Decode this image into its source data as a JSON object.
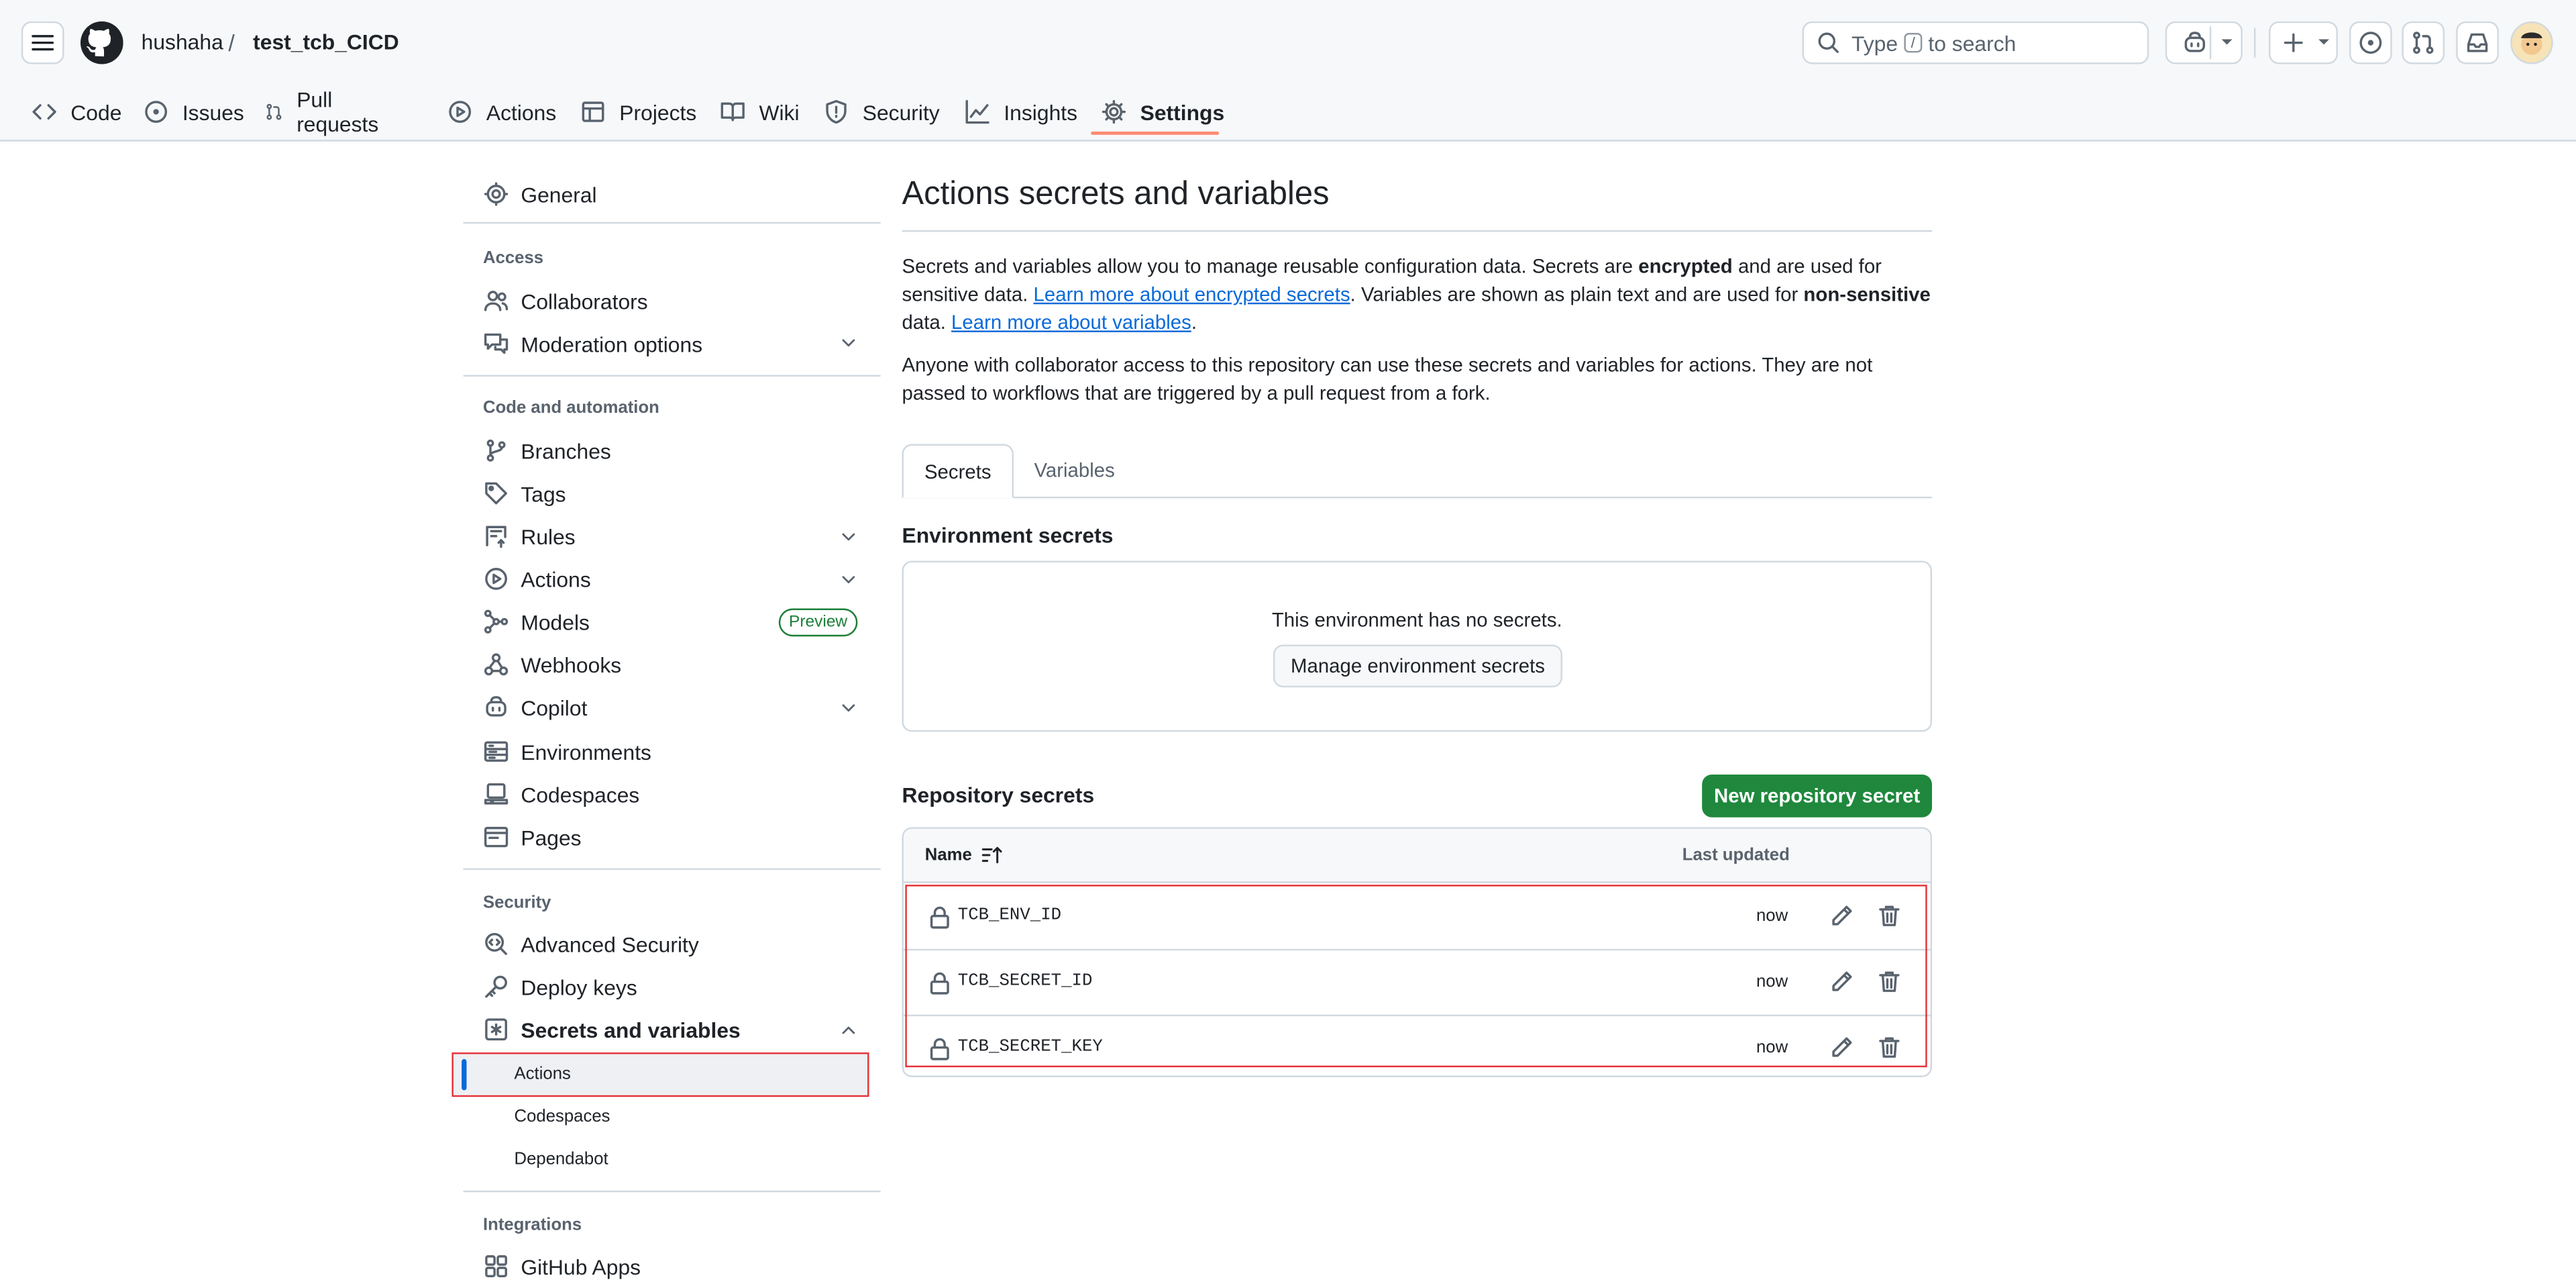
{
  "header": {
    "owner": "hushaha",
    "separator": "/",
    "repo": "test_tcb_CICD",
    "search_text_before": "Type",
    "search_key": "/",
    "search_text_after": "to search"
  },
  "repo_tabs": [
    {
      "label": "Code",
      "icon": "code-icon"
    },
    {
      "label": "Issues",
      "icon": "issue-icon"
    },
    {
      "label": "Pull requests",
      "icon": "pull-request-icon"
    },
    {
      "label": "Actions",
      "icon": "play-icon"
    },
    {
      "label": "Projects",
      "icon": "table-icon"
    },
    {
      "label": "Wiki",
      "icon": "book-icon"
    },
    {
      "label": "Security",
      "icon": "shield-icon"
    },
    {
      "label": "Insights",
      "icon": "graph-icon"
    },
    {
      "label": "Settings",
      "icon": "gear-icon",
      "active": true
    }
  ],
  "sidebar": {
    "general": "General",
    "access_heading": "Access",
    "collaborators": "Collaborators",
    "moderation": "Moderation options",
    "code_heading": "Code and automation",
    "branches": "Branches",
    "tags": "Tags",
    "rules": "Rules",
    "actions": "Actions",
    "models": "Models",
    "preview_badge": "Preview",
    "webhooks": "Webhooks",
    "copilot": "Copilot",
    "environments": "Environments",
    "codespaces": "Codespaces",
    "pages": "Pages",
    "security_heading": "Security",
    "advanced_security": "Advanced Security",
    "deploy_keys": "Deploy keys",
    "secrets_variables": "Secrets and variables",
    "sub_actions": "Actions",
    "sub_codespaces": "Codespaces",
    "sub_dependabot": "Dependabot",
    "integrations_heading": "Integrations",
    "github_apps": "GitHub Apps"
  },
  "main": {
    "title": "Actions secrets and variables",
    "intro_1": "Secrets and variables allow you to manage reusable configuration data. Secrets are ",
    "intro_bold_1": "encrypted",
    "intro_2": " and are used for sensitive data. ",
    "intro_link_1": "Learn more about encrypted secrets",
    "intro_3": ". Variables are shown as plain text and are used for ",
    "intro_bold_2": "non-sensitive",
    "intro_4": " data. ",
    "intro_link_2": "Learn more about variables",
    "intro_5": ".",
    "access_note": "Anyone with collaborator access to this repository can use these secrets and variables for actions. They are not passed to workflows that are triggered by a pull request from a fork.",
    "tab_secrets": "Secrets",
    "tab_variables": "Variables",
    "env_heading": "Environment secrets",
    "env_empty": "This environment has no secrets.",
    "env_button": "Manage environment secrets",
    "repo_heading": "Repository secrets",
    "new_button": "New repository secret",
    "col_name": "Name",
    "col_updated": "Last updated",
    "secrets": [
      {
        "name": "TCB_ENV_ID",
        "updated": "now"
      },
      {
        "name": "TCB_SECRET_ID",
        "updated": "now"
      },
      {
        "name": "TCB_SECRET_KEY",
        "updated": "now"
      }
    ]
  },
  "colors": {
    "accent": "#0969da",
    "primary_button": "#1f883d",
    "highlight_border": "#e5333b",
    "tab_underline": "#fd8c73"
  }
}
